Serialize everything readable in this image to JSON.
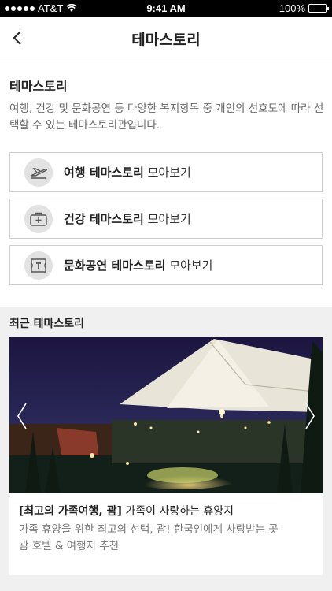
{
  "status": {
    "carrier": "AT&T",
    "time": "9:41 AM",
    "battery": "100%"
  },
  "header": {
    "title": "테마스토리"
  },
  "intro": {
    "title": "테마스토리",
    "description": "여행, 건강 및 문화공연 등 다양한 복지항목 중 개인의 선호도에 따라 선택할 수 있는 테마스토리관입니다."
  },
  "menu": [
    {
      "bold": "여행 테마스토리",
      "light": " 모아보기",
      "icon": "airplane-icon"
    },
    {
      "bold": "건강 테마스토리",
      "light": " 모아보기",
      "icon": "medical-kit-icon"
    },
    {
      "bold": "문화공연 테마스토리",
      "light": " 모아보기",
      "icon": "ticket-icon"
    }
  ],
  "recent": {
    "title": "최근 테마스토리",
    "card": {
      "title_bold": "[최고의 가족여행, 괌]",
      "title_rest": " 가족이 사랑하는 휴양지",
      "desc_line1": "가족 휴양을 위한 최고의 선택, 괌! 한국인에게 사랑받는 곳",
      "desc_line2": "괌 호텔 & 여행지 추천"
    }
  }
}
